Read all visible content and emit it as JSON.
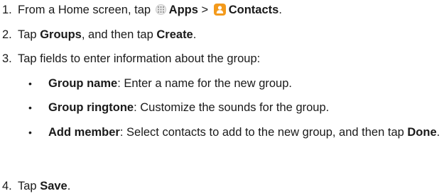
{
  "steps": [
    {
      "num": "1.",
      "t1": "From a Home screen, tap ",
      "apps": "Apps",
      "sep": " > ",
      "contacts": "Contacts",
      "end": "."
    },
    {
      "num": "2.",
      "t1": "Tap ",
      "b1": "Groups",
      "t2": ", and then tap ",
      "b2": "Create",
      "end": "."
    },
    {
      "num": "3.",
      "text": "Tap fields to enter information about the group:"
    },
    {
      "num": "4.",
      "t1": "Tap ",
      "b1": "Save",
      "end": "."
    }
  ],
  "bullets": [
    {
      "marker": "•",
      "term": "Group name",
      "desc": ": Enter a name for the new group."
    },
    {
      "marker": "•",
      "term": "Group ringtone",
      "desc": ": Customize the sounds for the group."
    },
    {
      "marker": "•",
      "term": "Add member",
      "desc": ": Select contacts to add to the new group, and then tap ",
      "term2": "Done",
      "end": "."
    }
  ],
  "icons": {
    "apps": "apps-grid-icon",
    "contacts": "contacts-person-icon",
    "contacts_color": "#f39a1c"
  }
}
